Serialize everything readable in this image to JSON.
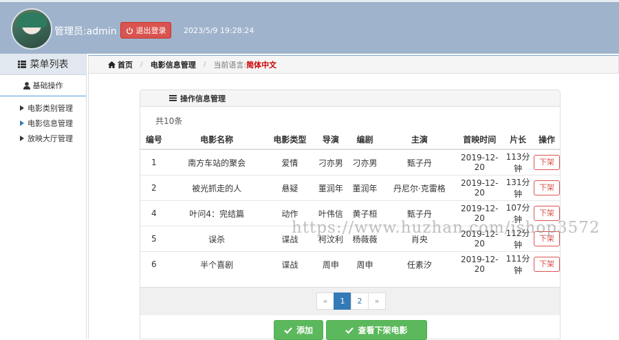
{
  "header": {
    "admin_label": "管理员:admin",
    "logout_label": "退出登录",
    "datetime": "2023/5/9 19:28:24"
  },
  "sidebar": {
    "title": "菜单列表",
    "section": "基础操作",
    "items": [
      {
        "label": "电影类别管理"
      },
      {
        "label": "电影信息管理"
      },
      {
        "label": "放映大厅管理"
      }
    ]
  },
  "breadcrumb": {
    "home": "首页",
    "current": "电影信息管理",
    "lang_label": "当前语言:",
    "lang_value": "简体中文"
  },
  "panel": {
    "title": "操作信息管理",
    "count": "共10条",
    "columns": [
      "编号",
      "电影名称",
      "电影类型",
      "导演",
      "编剧",
      "主演",
      "首映时间",
      "片长",
      "操作"
    ],
    "rows": [
      [
        "1",
        "南方车站的聚会",
        "爱情",
        "刁亦男",
        "刁亦男",
        "甄子丹",
        "2019-12-20",
        "113分钟",
        "下架"
      ],
      [
        "2",
        "被光抓走的人",
        "悬疑",
        "董润年",
        "董润年",
        "丹尼尔·克雷格",
        "2019-12-20",
        "131分钟",
        "下架"
      ],
      [
        "4",
        "叶问4：完结篇",
        "动作",
        "叶伟信",
        "黄子桓",
        "甄子丹",
        "2019-12-20",
        "107分钟",
        "下架"
      ],
      [
        "5",
        "误杀",
        "谍战",
        "柯汶利",
        "杨薇薇",
        "肖央",
        "2019-12-20",
        "112分钟",
        "下架"
      ],
      [
        "6",
        "半个喜剧",
        "谍战",
        "周申",
        "周申",
        "任素汐",
        "2019-12-20",
        "111分钟",
        "下架"
      ]
    ],
    "pagination": {
      "prev": "«",
      "pages": [
        "1",
        "2"
      ],
      "active": "1",
      "next": "»"
    },
    "add_label": "添加",
    "view_offshelf_label": "查看下架电影"
  },
  "watermark": "https://www.huzhan.com/ishop3572",
  "colors": {
    "header_bg": "#9fb3cc",
    "danger": "#d9534f",
    "primary": "#337ab7",
    "success": "#5cb85c"
  }
}
